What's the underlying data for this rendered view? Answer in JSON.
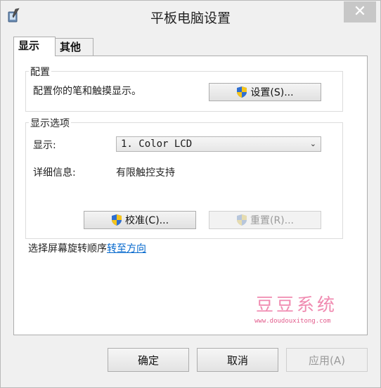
{
  "window": {
    "title": "平板电脑设置",
    "close_glyph": "✕"
  },
  "tabs": [
    {
      "label": "显示",
      "active": true
    },
    {
      "label": "其他",
      "active": false
    }
  ],
  "config_group": {
    "title": "配置",
    "description": "配置你的笔和触摸显示。",
    "setup_button": "设置(S)..."
  },
  "display_options": {
    "title": "显示选项",
    "display_label": "显示:",
    "display_value": "1. Color LCD",
    "details_label": "详细信息:",
    "details_value": "有限触控支持",
    "calibrate_button": "校准(C)...",
    "reset_button": "重置(R)..."
  },
  "rotation": {
    "text": "选择屏幕旋转顺序",
    "link": "转至方向"
  },
  "watermark": {
    "brand": "豆豆系统",
    "url": "www.doudouxitong.com"
  },
  "footer": {
    "ok": "确定",
    "cancel": "取消",
    "apply": "应用(A)"
  },
  "colors": {
    "link": "#0066cc",
    "watermark": "#f08ab0",
    "close_button": "#c7c7c7"
  }
}
